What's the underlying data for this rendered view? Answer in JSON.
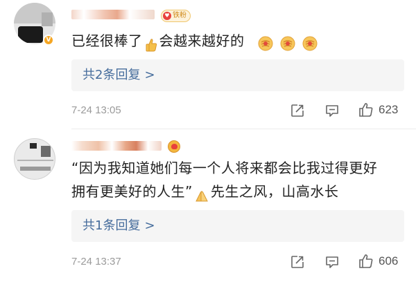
{
  "comments": [
    {
      "fan_badge": "铁粉",
      "text": "已经很棒了",
      "text_after_thumb": "会越来越好的",
      "reply_link": "共2条回复",
      "reply_arrow": ">",
      "time": "7-24 13:05",
      "likes": "623"
    },
    {
      "text_line1": "“因为我知道她们每一个人将来都会比我过得更好",
      "text_line2": "拥有更美好的人生”",
      "text_after_emoji": "先生之风，山高水长",
      "reply_link": "共1条回复",
      "reply_arrow": ">",
      "time": "7-24 13:37",
      "likes": "606"
    }
  ],
  "colors": {
    "link": "#456c9c",
    "meta": "#9a9a9a",
    "reply_bg": "#f5f5f5",
    "fan_badge": "#f0c66c"
  },
  "icons": [
    "share-icon",
    "comment-icon",
    "like-icon",
    "thumbs-up-emoji",
    "fist-emoji",
    "praying-hands-emoji",
    "verified-badge-icon",
    "fan-heart-icon"
  ]
}
